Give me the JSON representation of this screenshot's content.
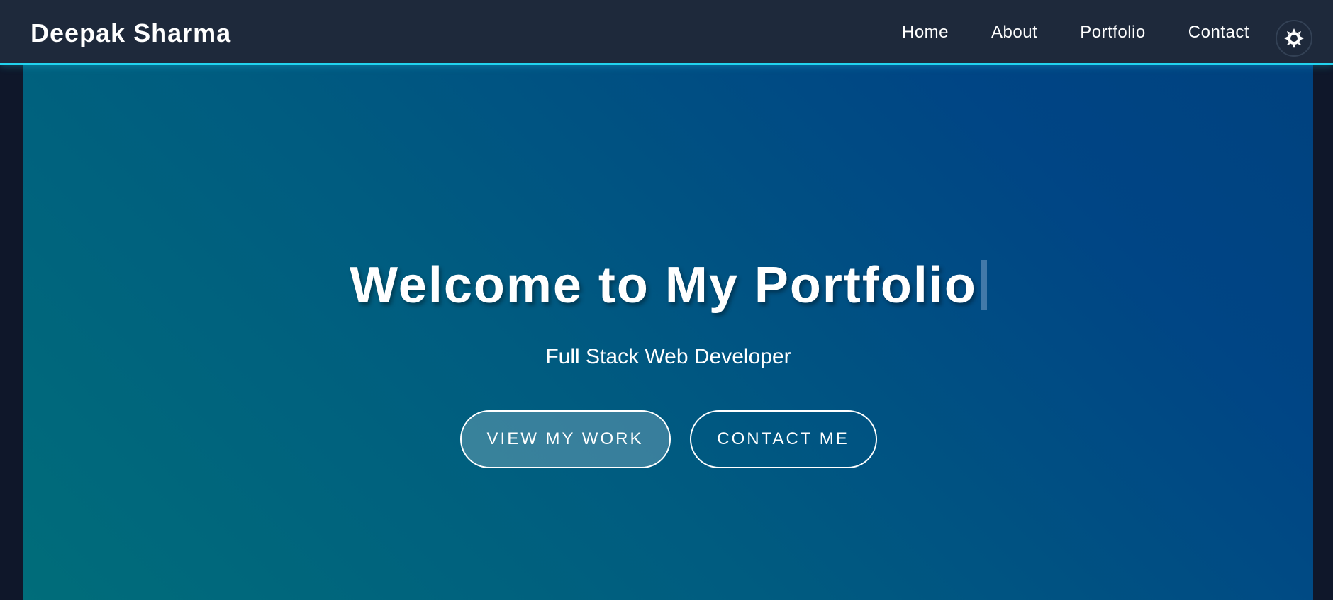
{
  "header": {
    "brand": "Deepak Sharma",
    "nav": [
      {
        "label": "Home"
      },
      {
        "label": "About"
      },
      {
        "label": "Portfolio"
      },
      {
        "label": "Contact"
      }
    ],
    "theme_toggle_icon": "sun-icon"
  },
  "hero": {
    "title": "Welcome to My Portfolio",
    "subtitle": "Full Stack Web Developer",
    "primary_button": "VIEW MY WORK",
    "secondary_button": "CONTACT ME"
  },
  "colors": {
    "navbar_bg": "#1e293b",
    "accent": "#22d3ee",
    "hero_gradient_start": "#006d7a",
    "hero_gradient_end": "#00427f",
    "page_bg": "#0f172a"
  }
}
